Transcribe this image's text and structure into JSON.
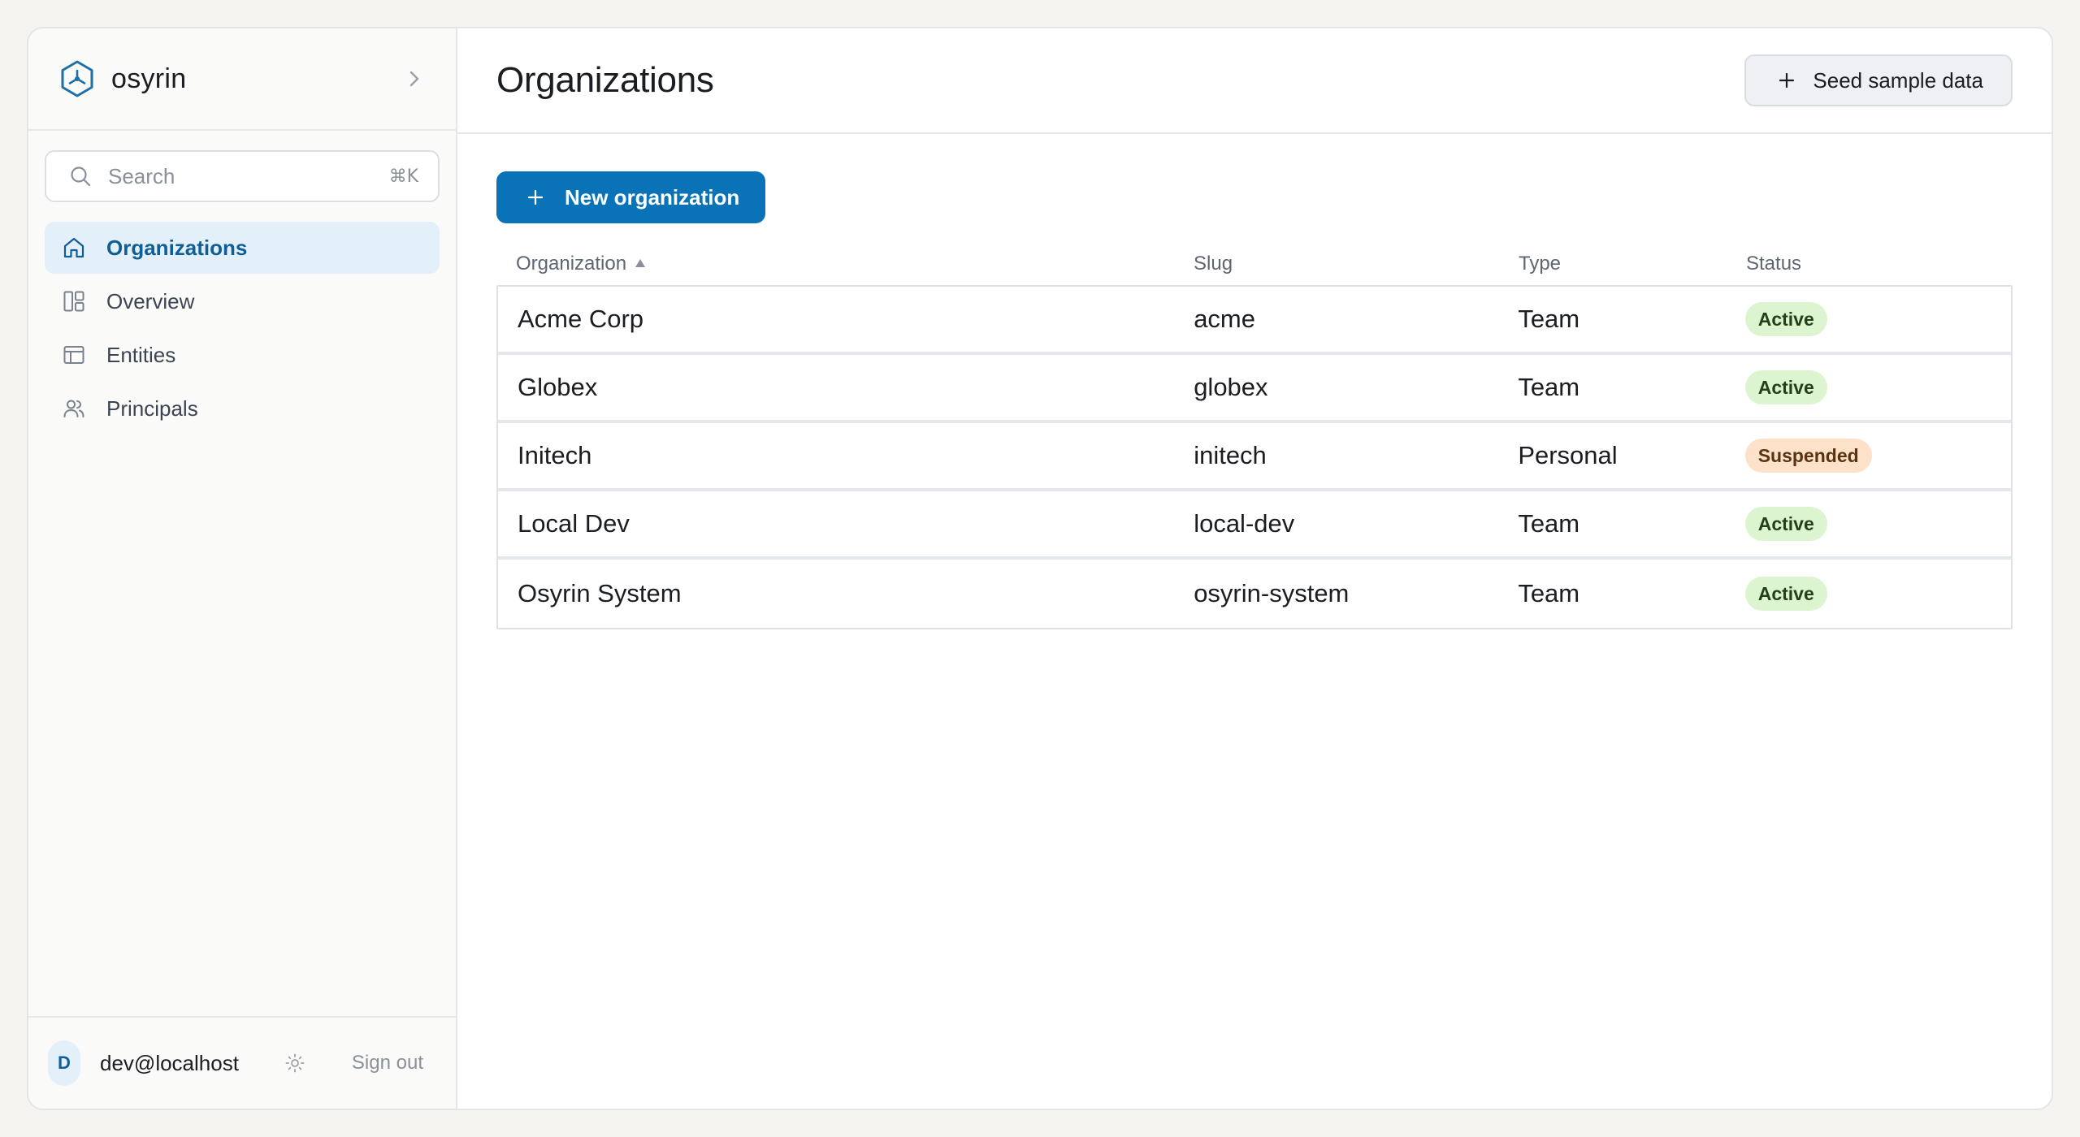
{
  "brand": {
    "name": "osyrin",
    "logo_icon": "hexagon-logo-icon",
    "collapse_icon": "chevron-right-icon"
  },
  "search": {
    "placeholder": "Search",
    "shortcut": "⌘K"
  },
  "sidebar": {
    "items": [
      {
        "label": "Organizations",
        "icon": "home-icon",
        "active": true
      },
      {
        "label": "Overview",
        "icon": "dashboard-icon",
        "active": false
      },
      {
        "label": "Entities",
        "icon": "table-icon",
        "active": false
      },
      {
        "label": "Principals",
        "icon": "users-icon",
        "active": false
      }
    ]
  },
  "user": {
    "initial": "D",
    "email": "dev@localhost",
    "signout_label": "Sign out",
    "theme_icon": "sun-icon"
  },
  "header": {
    "title": "Organizations",
    "seed_label": "Seed sample data"
  },
  "toolbar": {
    "new_label": "New organization"
  },
  "table": {
    "columns": {
      "organization": "Organization",
      "slug": "Slug",
      "type": "Type",
      "status": "Status"
    },
    "sort": {
      "column": "organization",
      "direction": "ascending"
    },
    "rows": [
      {
        "organization": "Acme Corp",
        "slug": "acme",
        "type": "Team",
        "status": "Active"
      },
      {
        "organization": "Globex",
        "slug": "globex",
        "type": "Team",
        "status": "Active"
      },
      {
        "organization": "Initech",
        "slug": "initech",
        "type": "Personal",
        "status": "Suspended"
      },
      {
        "organization": "Local Dev",
        "slug": "local-dev",
        "type": "Team",
        "status": "Active"
      },
      {
        "organization": "Osyrin System",
        "slug": "osyrin-system",
        "type": "Team",
        "status": "Active"
      }
    ]
  },
  "colors": {
    "accent": "#0a73b8",
    "active_nav_bg": "#e3f0fa",
    "status_active_bg": "#dcf5d0",
    "status_suspended_bg": "#fde2c9"
  }
}
